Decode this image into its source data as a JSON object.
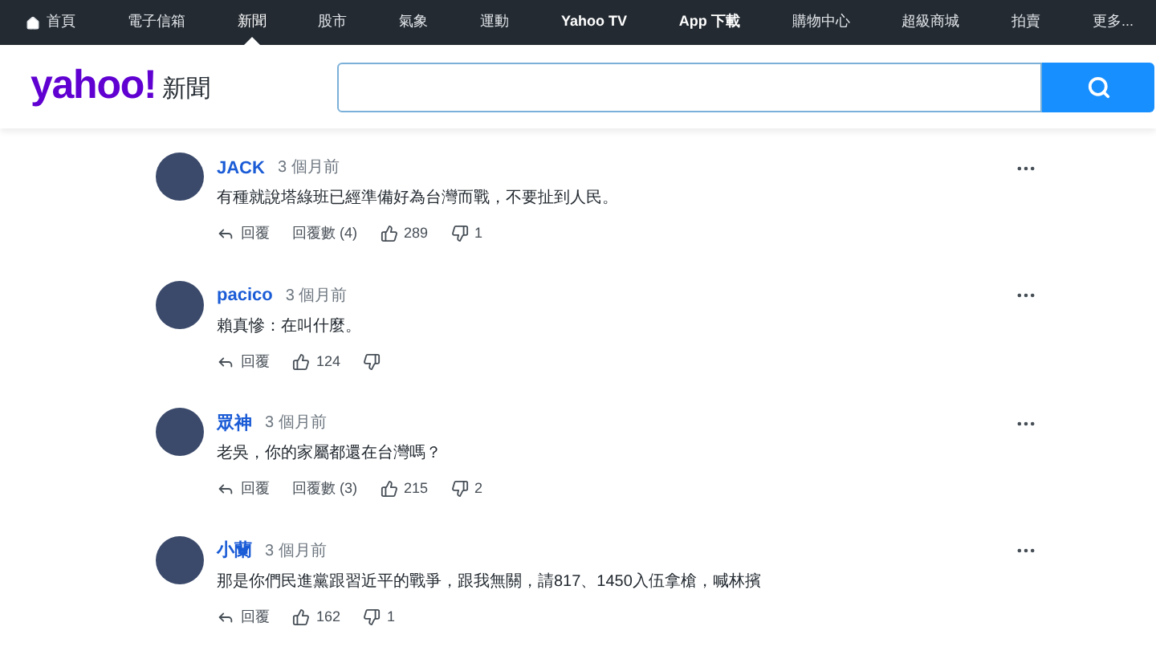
{
  "nav": [
    {
      "label": "首頁",
      "kind": "home",
      "selected": false,
      "bold": false
    },
    {
      "label": "電子信箱",
      "kind": "link",
      "selected": false,
      "bold": false
    },
    {
      "label": "新聞",
      "kind": "link",
      "selected": true,
      "bold": false
    },
    {
      "label": "股市",
      "kind": "link",
      "selected": false,
      "bold": false
    },
    {
      "label": "氣象",
      "kind": "link",
      "selected": false,
      "bold": false
    },
    {
      "label": "運動",
      "kind": "link",
      "selected": false,
      "bold": false
    },
    {
      "label": "Yahoo TV",
      "kind": "link",
      "selected": false,
      "bold": true
    },
    {
      "label": "App 下載",
      "kind": "link",
      "selected": false,
      "bold": true
    },
    {
      "label": "購物中心",
      "kind": "link",
      "selected": false,
      "bold": false
    },
    {
      "label": "超級商城",
      "kind": "link",
      "selected": false,
      "bold": false
    },
    {
      "label": "拍賣",
      "kind": "link",
      "selected": false,
      "bold": false
    },
    {
      "label": "更多...",
      "kind": "link",
      "selected": false,
      "bold": false
    }
  ],
  "header": {
    "logo": "yahoo!",
    "section": "新聞"
  },
  "comments": [
    {
      "name": "JACK",
      "time": "3 個月前",
      "text": "有種就說塔綠班已經準備好為台灣而戰，不要扯到人民。",
      "reply": "回覆",
      "replies": "回覆數 (4)",
      "likes": "289",
      "dislikes": "1"
    },
    {
      "name": "pacico",
      "time": "3 個月前",
      "text": "賴真慘：在叫什麼。",
      "reply": "回覆",
      "likes": "124"
    },
    {
      "name": "眾神",
      "time": "3 個月前",
      "text": "老吳，你的家屬都還在台灣嗎？",
      "reply": "回覆",
      "replies": "回覆數 (3)",
      "likes": "215",
      "dislikes": "2"
    },
    {
      "name": "小蘭",
      "time": "3 個月前",
      "text": "那是你們民進黨跟習近平的戰爭，跟我無關，請817、1450入伍拿槍，喊林擯",
      "reply": "回覆",
      "likes": "162",
      "dislikes": "1"
    }
  ]
}
